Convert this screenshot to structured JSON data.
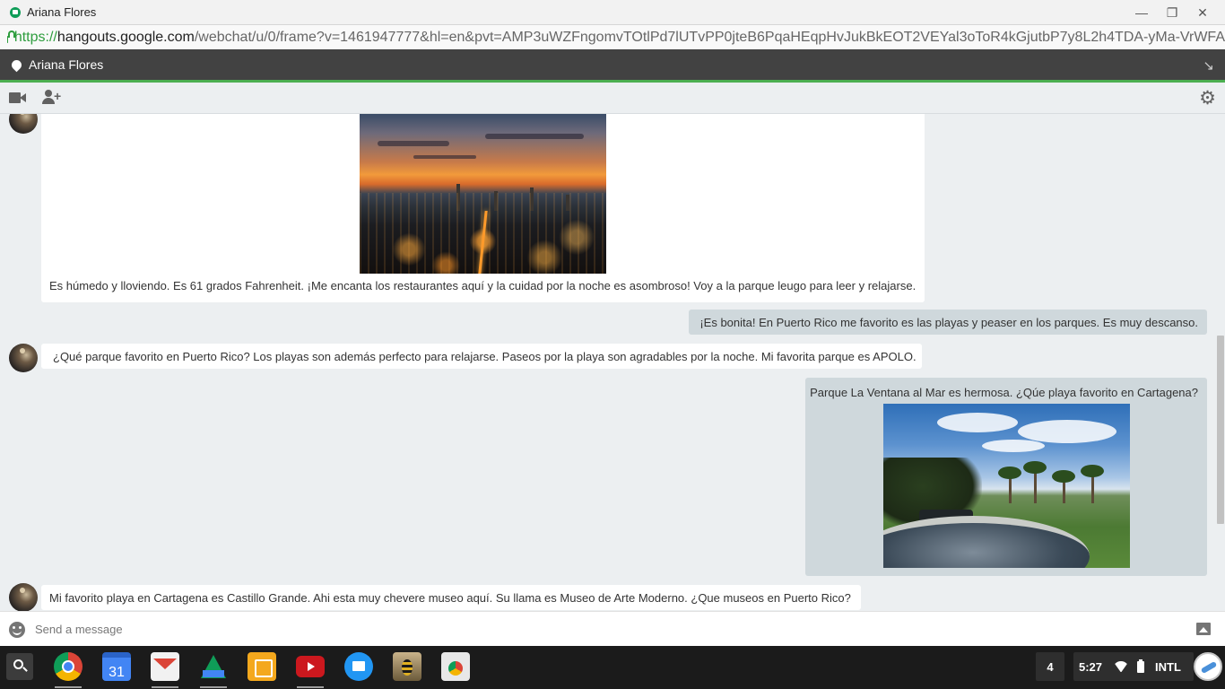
{
  "window": {
    "title": "Ariana Flores",
    "minimize_label": "—",
    "restore_label": "❐",
    "close_label": "✕"
  },
  "address_bar": {
    "scheme": "https://",
    "host": "hangouts.google.com",
    "path": "/webchat/u/0/frame?v=1461947777&hl=en&pvt=AMP3uWZFngomvTOtlPd7lUTvPP0jteB6PqaHEqpHvJukBkEOT2VEYal3oToR4kGjutbP7y8L2h4TDA-yMa-VrWFA"
  },
  "conversation": {
    "contact_name": "Ariana Flores",
    "popout_label": "↘",
    "accent_color": "#4caf50"
  },
  "toolbar": {
    "gear_label": "⚙"
  },
  "messages": [
    {
      "from": "contact",
      "has_image": true,
      "image_subject": "sunset-city",
      "text": "Es húmedo y lloviendo. Es 61 grados Fahrenheit. ¡Me encanta los restaurantes aquí y la cuidad por la noche es asombroso! Voy a la parque leugo para leer y relajarse."
    },
    {
      "from": "me",
      "has_image": false,
      "text": "¡Es bonita! En Puerto Rico me favorito es las playas y peaser en los parques. Es muy descanso."
    },
    {
      "from": "contact",
      "has_image": false,
      "text": "¿Qué parque favorito en Puerto Rico? Los playas son además perfecto para relajarse. Paseos por la playa son agradables por la noche. Mi favorita parque es APOLO."
    },
    {
      "from": "me",
      "has_image": true,
      "image_subject": "park-pool",
      "text": "Parque La Ventana al Mar es hermosa. ¿Qúe playa favorito en Cartagena?"
    },
    {
      "from": "contact",
      "has_image": false,
      "text": "Mi favorito playa en Cartagena es Castillo Grande. Ahi esta muy chevere museo aquí. Su llama es Museo de Arte Moderno. ¿Que museos en Puerto Rico?"
    }
  ],
  "composer": {
    "placeholder": "Send a message",
    "value": ""
  },
  "shelf": {
    "apps": [
      "chrome-icon",
      "calendar-icon",
      "gmail-icon",
      "drive-icon",
      "slides-icon",
      "youtube-icon",
      "files-icon",
      "bee-icon",
      "webstore-icon"
    ],
    "calendar_day": "31",
    "notification_count": "4",
    "time": "5:27",
    "keyboard_layout": "INTL"
  }
}
